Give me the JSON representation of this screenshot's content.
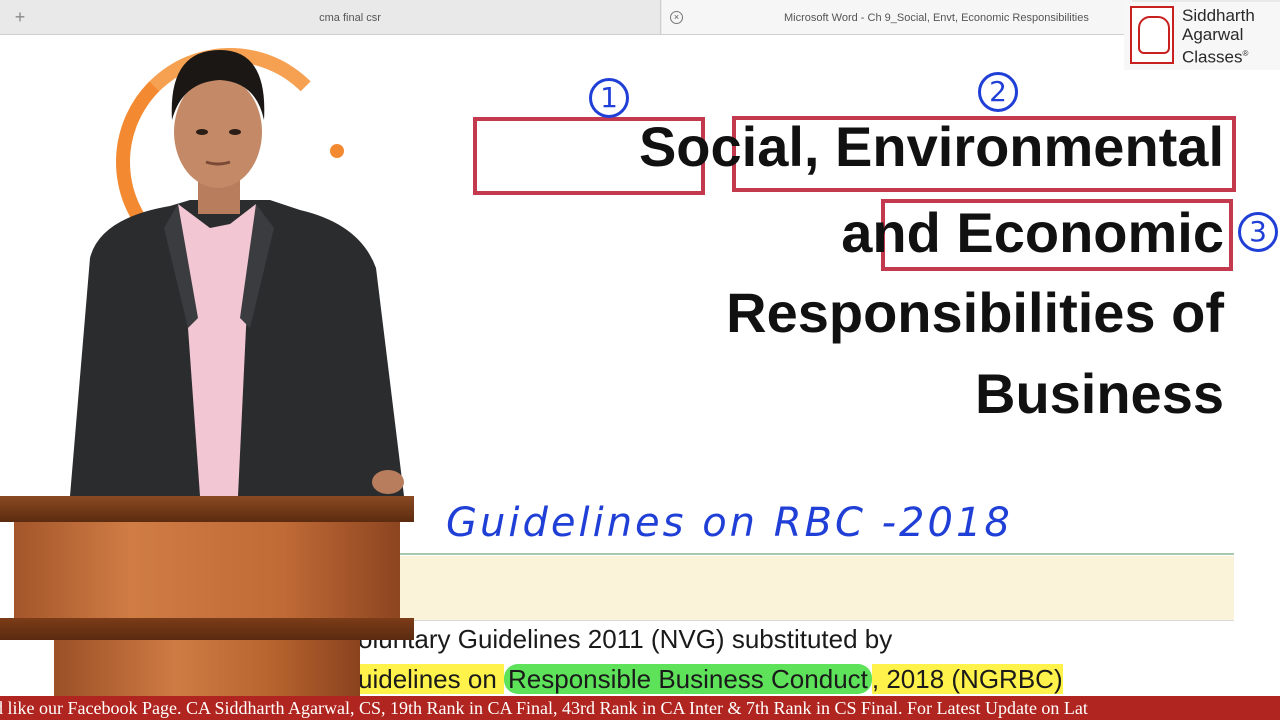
{
  "tabs": [
    {
      "label": "cma final csr"
    },
    {
      "label": "Microsoft Word - Ch 9_Social, Envt, Economic Responsibilities"
    }
  ],
  "logo": {
    "line1": "Siddharth",
    "line2": "Agarwal",
    "line3": "Classes",
    "mark": "®"
  },
  "heading": {
    "word1": "Social",
    "comma": ",",
    "word2": "Environmental",
    "line2_prefix": "and",
    "word3": "Economic",
    "line3": "Responsibilities of",
    "line4": "Business"
  },
  "annotations": {
    "n1": "1",
    "n2": "2",
    "n3": "3",
    "handwritten": "Guidelines on RBC -2018"
  },
  "body_text": {
    "line1": "oluntary Guidelines 2011 (NVG) substituted by",
    "line2_a": "uidelines on ",
    "line2_highlight": "Responsible Business Conduct",
    "line2_b": ", 2018 (NGRBC)"
  },
  "ticker": {
    "text": "d like our Facebook Page. CA Siddharth Agarwal, CS, 19th Rank in CA Final, 43rd Rank in CA Inter & 7th Rank in CS Final. For Latest Update on Lat"
  },
  "colors": {
    "box": "#c33a4f",
    "ink": "#1f3fd6",
    "ticker_bg": "#b0251f",
    "halo": "#f38a32",
    "highlight_yellow": "#fff24a",
    "highlight_green": "#5ee25a"
  }
}
